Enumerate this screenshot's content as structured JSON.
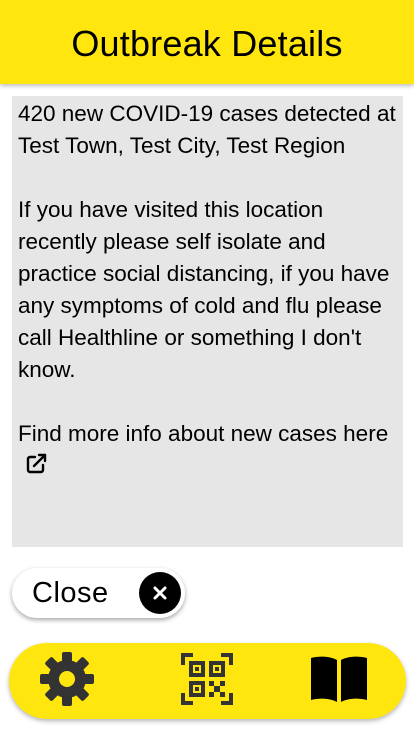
{
  "header": {
    "title": "Outbreak Details"
  },
  "details": {
    "cases_text": "420 new COVID-19 cases detected at Test Town, Test City, Test Region",
    "advice_text": "If you have visited this location recently please self isolate and practice social distancing, if you have any symptoms of cold and flu please call Healthline or something I don't know.",
    "more_info_text": "Find more info about new cases here",
    "more_info_icon": "external-link-icon"
  },
  "close_button": {
    "label": "Close",
    "icon": "close-icon"
  },
  "bottom_nav": {
    "items": [
      {
        "icon": "gear-icon"
      },
      {
        "icon": "qr-code-icon"
      },
      {
        "icon": "book-icon"
      }
    ]
  },
  "colors": {
    "accent": "#FFE60F",
    "panel": "#E6E6E6",
    "text": "#000000",
    "icon_dark": "#333333"
  }
}
